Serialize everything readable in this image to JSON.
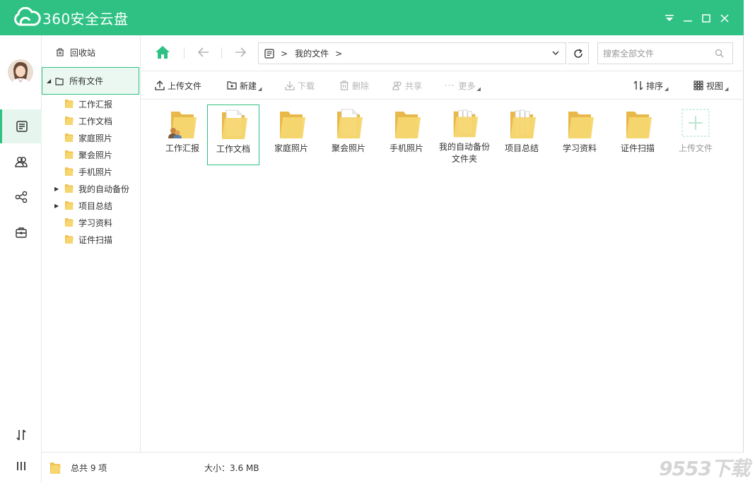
{
  "app": {
    "title": "360安全云盘"
  },
  "tree": {
    "trash_label": "回收站",
    "all_files_label": "所有文件",
    "items": [
      {
        "label": "工作汇报",
        "expandable": false
      },
      {
        "label": "工作文档",
        "expandable": false
      },
      {
        "label": "家庭照片",
        "expandable": false
      },
      {
        "label": "聚会照片",
        "expandable": false
      },
      {
        "label": "手机照片",
        "expandable": false
      },
      {
        "label": "我的自动备份",
        "expandable": true
      },
      {
        "label": "项目总结",
        "expandable": true
      },
      {
        "label": "学习资料",
        "expandable": false
      },
      {
        "label": "证件扫描",
        "expandable": false
      }
    ]
  },
  "address": {
    "crumb": "我的文件"
  },
  "search": {
    "placeholder": "搜索全部文件"
  },
  "toolbar": {
    "upload": "上传文件",
    "new": "新建",
    "download": "下载",
    "delete": "删除",
    "share": "共享",
    "more": "更多",
    "sort": "排序",
    "view": "视图"
  },
  "files": [
    {
      "name": "工作汇报",
      "icon": "folder-with-users-icon"
    },
    {
      "name": "工作文档",
      "icon": "folder-with-document-icon",
      "selected": true
    },
    {
      "name": "家庭照片",
      "icon": "folder-icon"
    },
    {
      "name": "聚会照片",
      "icon": "folder-with-document-icon"
    },
    {
      "name": "手机照片",
      "icon": "folder-icon"
    },
    {
      "name": "我的自动备份文件夹",
      "icon": "folder-with-files-icon"
    },
    {
      "name": "项目总结",
      "icon": "folder-with-files-icon"
    },
    {
      "name": "学习资料",
      "icon": "folder-icon"
    },
    {
      "name": "证件扫描",
      "icon": "folder-icon"
    }
  ],
  "upload_tile": {
    "label": "上传文件"
  },
  "status": {
    "count": "总共 9 项",
    "size": "大小：3.6 MB"
  },
  "watermark": "9553下载",
  "colors": {
    "accent": "#2ec183",
    "folder": "#f3cc62"
  }
}
